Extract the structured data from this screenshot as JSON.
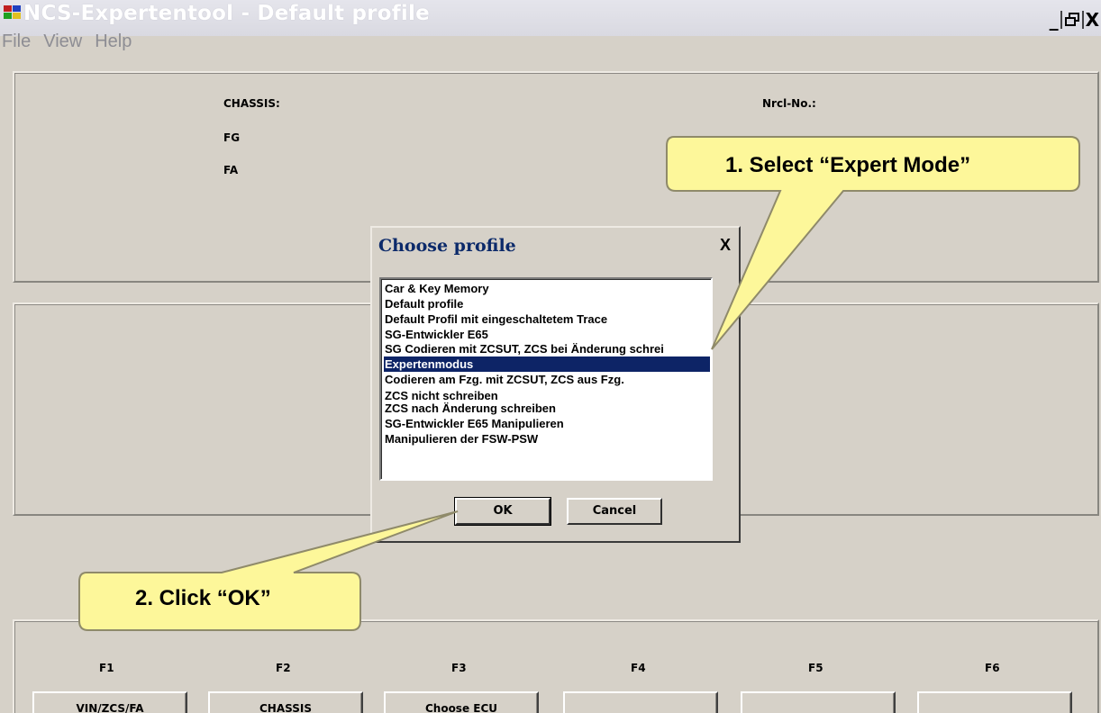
{
  "window": {
    "title": "NCS-Expertentool - Default profile",
    "minimize": "_",
    "restore": "🗗",
    "close": "X"
  },
  "menu": [
    "File",
    "View",
    "Help"
  ],
  "info": {
    "chassis_label": "CHASSIS:",
    "fg_label": "FG",
    "fa_label": "FA",
    "nrcl_label": "Nrcl-No.:"
  },
  "dialog": {
    "title": "Choose profile",
    "close": "X",
    "items": [
      "Car & Key Memory",
      "Default profile",
      "Default Profil mit eingeschaltetem Trace",
      "SG-Entwickler E65",
      "SG Codieren mit ZCSUT, ZCS bei Änderung schrei",
      "Expertenmodus",
      "Codieren am Fzg. mit ZCSUT, ZCS aus Fzg.",
      "ZCS nicht schreiben",
      "ZCS nach Änderung schreiben",
      "SG-Entwickler E65 Manipulieren",
      "Manipulieren der FSW-PSW"
    ],
    "selected_index": 5,
    "ok_label": "OK",
    "cancel_label": "Cancel"
  },
  "function_keys": {
    "labels": [
      "F1",
      "F2",
      "F3",
      "F4",
      "F5",
      "F6"
    ],
    "buttons": [
      "VIN/ZCS/FA",
      "CHASSIS",
      "Choose ECU",
      "",
      "",
      ""
    ]
  },
  "callouts": {
    "step1": "1. Select “Expert Mode”",
    "step2": "2. Click “OK”",
    "fill_color": "#fdf79a",
    "stroke_color": "#8f8a6a"
  },
  "colors": {
    "background": "#d6d1c8",
    "selection": "#0d2466",
    "dialog_title": "#0c2a6a"
  }
}
